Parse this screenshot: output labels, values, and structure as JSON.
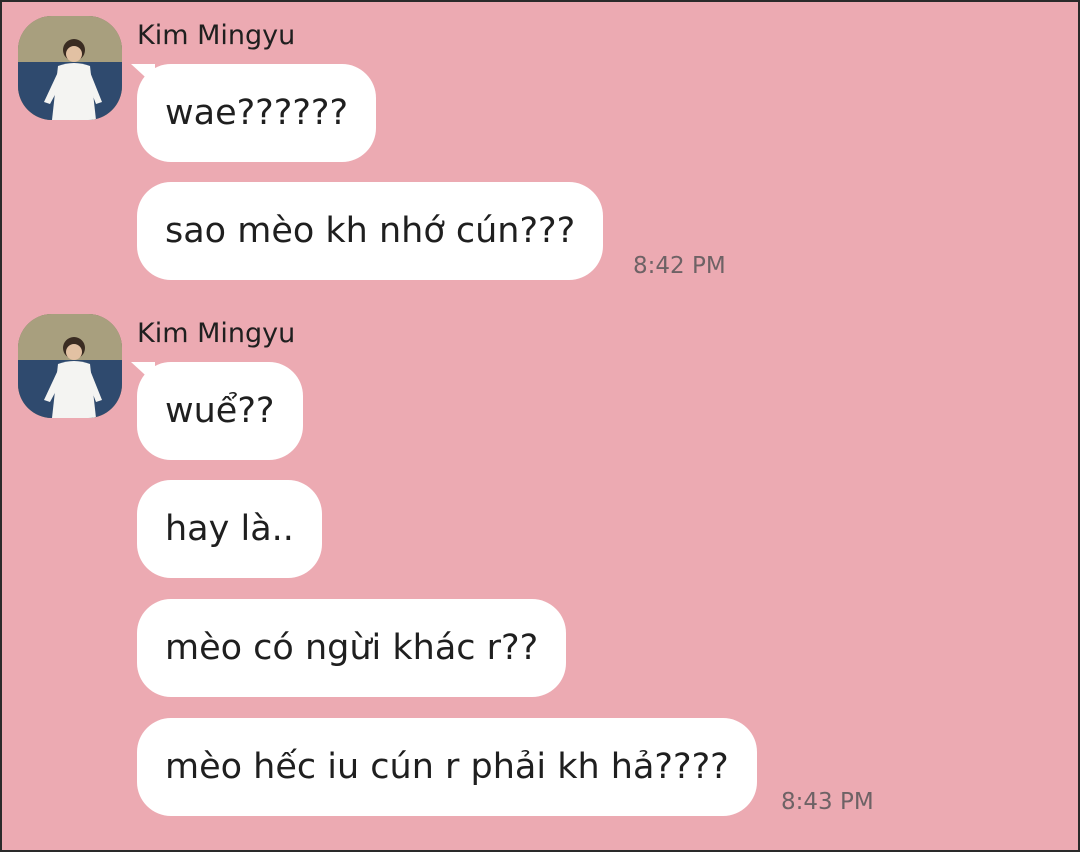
{
  "colors": {
    "background": "#ecaab2",
    "bubble": "#ffffff",
    "text": "#1f1f1f",
    "timestamp": "#6e6265"
  },
  "groups": [
    {
      "sender": "Kim Mingyu",
      "avatar_icon": "profile-photo",
      "messages": [
        "wae??????",
        "sao mèo kh nhớ cún???"
      ],
      "time": "8:42 PM"
    },
    {
      "sender": "Kim Mingyu",
      "avatar_icon": "profile-photo",
      "messages": [
        "wuể??",
        "hay là..",
        "mèo có ngừi khác r??",
        "mèo hếc iu cún r phải kh hả????"
      ],
      "time": "8:43 PM"
    }
  ]
}
